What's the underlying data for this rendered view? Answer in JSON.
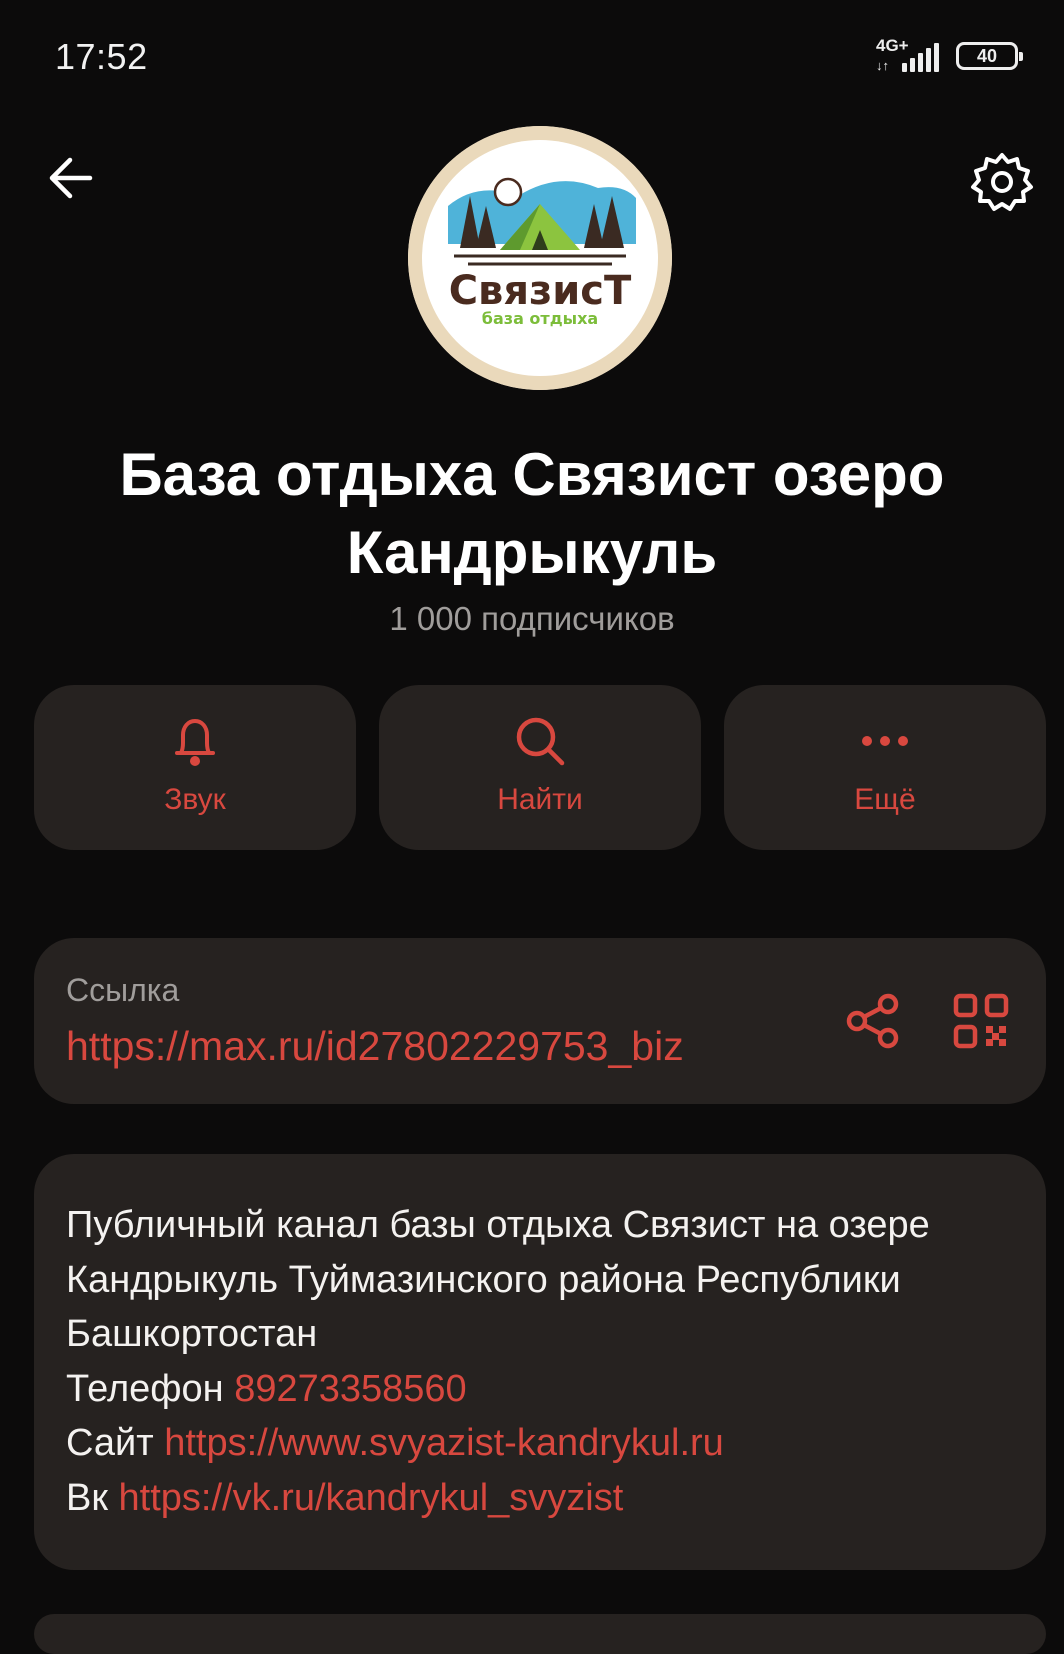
{
  "status_bar": {
    "time": "17:52",
    "network": "4G+",
    "network_arrows": "↓↑",
    "battery": "40"
  },
  "header": {
    "back_icon": "arrow-left-icon",
    "settings_icon": "gear-icon"
  },
  "avatar": {
    "logo_text": "СвязисТ",
    "logo_subtext": "база отдыха"
  },
  "channel": {
    "title": "База отдыха Связист озеро Кандрыкуль",
    "subscribers": "1 000 подписчиков"
  },
  "actions": [
    {
      "label": "Звук",
      "icon": "bell-icon"
    },
    {
      "label": "Найти",
      "icon": "search-icon"
    },
    {
      "label": "Ещё",
      "icon": "more-dots-icon"
    }
  ],
  "link": {
    "caption": "Ссылка",
    "url": "https://max.ru/id27802229753_biz",
    "share_icon": "share-icon",
    "qr_icon": "qr-code-icon"
  },
  "description": {
    "text": "Публичный канал базы отдыха Связист на озере Кандрыкуль Туймазинского района Республики Башкортостан",
    "phone_label": "Телефон",
    "phone": "89273358560",
    "site_label": "Сайт",
    "site": "https://www.svyazist-kandrykul.ru",
    "vk_label": "Вк",
    "vk": "https://vk.ru/kandrykul_svyzist"
  },
  "colors": {
    "background": "#0c0b0b",
    "card": "#262220",
    "accent": "#d8483f",
    "muted": "#a09d9b"
  }
}
